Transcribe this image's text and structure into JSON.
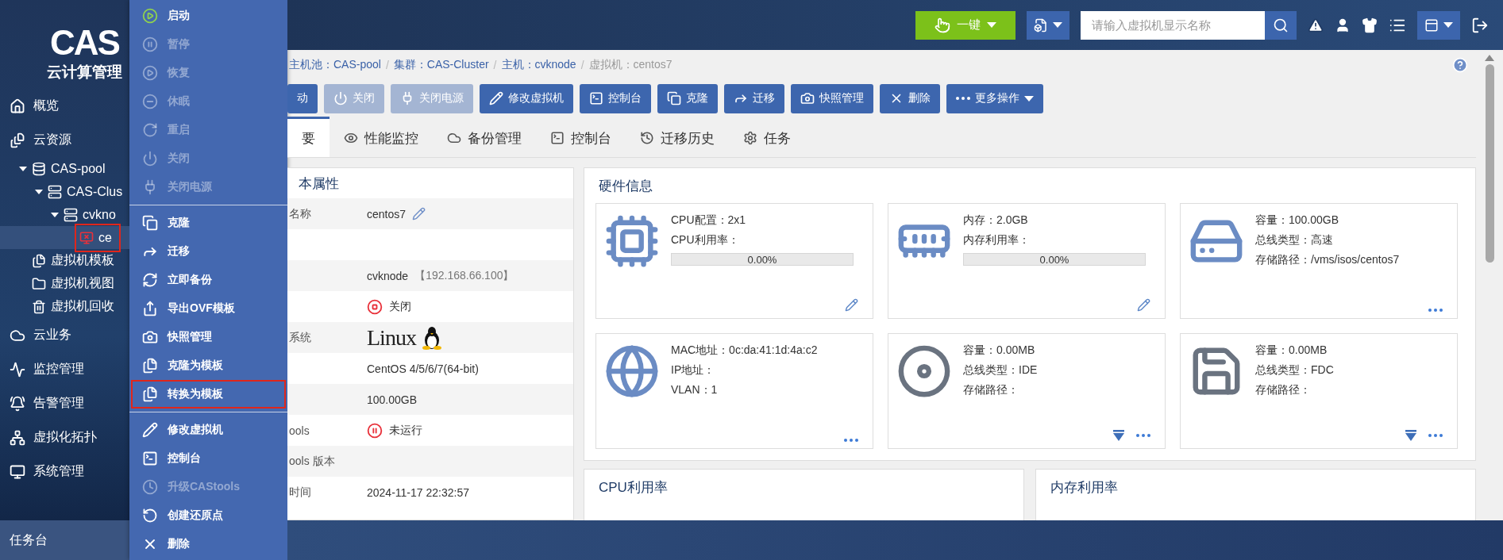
{
  "logo": {
    "mark": "CAS",
    "title": "云计算管理"
  },
  "sidebar": {
    "items": [
      {
        "label": "概览",
        "kind": "home",
        "selected": false
      },
      {
        "label": "云资源",
        "kind": "resources",
        "selected": false,
        "children": [
          {
            "label": "CAS-pool",
            "kind": "pool",
            "expanded": true,
            "selected": false,
            "highlighted": false,
            "children": [
              {
                "label": "CAS-Clus",
                "kind": "cluster",
                "expanded": true,
                "selected": false,
                "highlighted": false,
                "children": [
                  {
                    "label": "cvkno",
                    "kind": "host",
                    "expanded": true,
                    "selected": false,
                    "highlighted": false,
                    "children": [
                      {
                        "label": "ce",
                        "kind": "vm",
                        "selected": true,
                        "highlighted": true
                      }
                    ]
                  }
                ]
              }
            ]
          },
          {
            "label": "虚拟机模板",
            "kind": "template",
            "selected": false,
            "highlighted": false
          },
          {
            "label": "虚拟机视图",
            "kind": "folder",
            "selected": false,
            "highlighted": false
          },
          {
            "label": "虚拟机回收",
            "kind": "trash",
            "selected": false,
            "highlighted": false
          }
        ]
      },
      {
        "label": "云业务",
        "kind": "cloud",
        "selected": false
      },
      {
        "label": "监控管理",
        "kind": "monitor",
        "selected": false
      },
      {
        "label": "告警管理",
        "kind": "alarm",
        "selected": false
      },
      {
        "label": "虚拟化拓扑",
        "kind": "topology",
        "selected": false
      },
      {
        "label": "系统管理",
        "kind": "system",
        "selected": false
      }
    ]
  },
  "context_menu": {
    "groups": [
      {
        "items": [
          {
            "label": "启动",
            "kind": "start",
            "disabled": false,
            "highlighted": false
          },
          {
            "label": "暂停",
            "kind": "pause",
            "disabled": true,
            "highlighted": false
          },
          {
            "label": "恢复",
            "kind": "resume",
            "disabled": true,
            "highlighted": false
          },
          {
            "label": "休眠",
            "kind": "sleep",
            "disabled": true,
            "highlighted": false
          },
          {
            "label": "重启",
            "kind": "restart",
            "disabled": true,
            "highlighted": false
          },
          {
            "label": "关闭",
            "kind": "power",
            "disabled": true,
            "highlighted": false
          },
          {
            "label": "关闭电源",
            "kind": "plug",
            "disabled": true,
            "highlighted": false
          }
        ]
      },
      {
        "items": [
          {
            "label": "克隆",
            "kind": "clone",
            "disabled": false,
            "highlighted": false
          },
          {
            "label": "迁移",
            "kind": "migrate",
            "disabled": false,
            "highlighted": false
          },
          {
            "label": "立即备份",
            "kind": "backup",
            "disabled": false,
            "highlighted": false
          },
          {
            "label": "导出OVF模板",
            "kind": "export",
            "disabled": false,
            "highlighted": false
          },
          {
            "label": "快照管理",
            "kind": "snapshot",
            "disabled": false,
            "highlighted": false
          },
          {
            "label": "克隆为模板",
            "kind": "template",
            "disabled": false,
            "highlighted": false
          },
          {
            "label": "转换为模板",
            "kind": "template",
            "disabled": false,
            "highlighted": true
          }
        ]
      },
      {
        "items": [
          {
            "label": "修改虚拟机",
            "kind": "edit",
            "disabled": false,
            "highlighted": false
          },
          {
            "label": "控制台",
            "kind": "console",
            "disabled": false,
            "highlighted": false
          },
          {
            "label": "升级CAStools",
            "kind": "upgrade",
            "disabled": true,
            "highlighted": false
          },
          {
            "label": "创建还原点",
            "kind": "restore",
            "disabled": false,
            "highlighted": false
          },
          {
            "label": "删除",
            "kind": "delete",
            "disabled": false,
            "highlighted": false
          }
        ]
      }
    ]
  },
  "topbar": {
    "quick_button": "一键",
    "search": {
      "placeholder": "请输入虚拟机显示名称"
    }
  },
  "breadcrumb": [
    {
      "label": "主机池：CAS-pool",
      "current": false
    },
    {
      "separator": "/",
      "label": "集群：CAS-Cluster",
      "current": false
    },
    {
      "separator": "/",
      "label": "主机：cvknode",
      "current": false
    },
    {
      "separator": "/",
      "label": "虚拟机：centos7",
      "current": true
    }
  ],
  "toolbar": [
    {
      "label": "动",
      "kind": "plain",
      "disabled": false
    },
    {
      "label": "关闭",
      "kind": "power",
      "disabled": true
    },
    {
      "label": "关闭电源",
      "kind": "plug",
      "disabled": true
    },
    {
      "label": "修改虚拟机",
      "kind": "edit",
      "disabled": false
    },
    {
      "label": "控制台",
      "kind": "console",
      "disabled": false
    },
    {
      "label": "克隆",
      "kind": "clone",
      "disabled": false
    },
    {
      "label": "迁移",
      "kind": "migrate",
      "disabled": false
    },
    {
      "label": "快照管理",
      "kind": "snapshot",
      "disabled": false
    },
    {
      "label": "删除",
      "kind": "delete",
      "disabled": false
    },
    {
      "label": "更多操作",
      "kind": "more",
      "disabled": false
    }
  ],
  "tabs": [
    {
      "label": "要",
      "kind": "plain",
      "selected": true
    },
    {
      "label": "性能监控",
      "kind": "monitoring",
      "selected": false
    },
    {
      "label": "备份管理",
      "kind": "backup",
      "selected": false
    },
    {
      "label": "控制台",
      "kind": "console",
      "selected": false
    },
    {
      "label": "迁移历史",
      "kind": "history",
      "selected": false
    },
    {
      "label": "任务",
      "kind": "task",
      "selected": false
    }
  ],
  "properties": {
    "title": "本属性",
    "rows": [
      {
        "kind": "editable",
        "label": "名称",
        "value": "centos7"
      },
      {
        "kind": "blank"
      },
      {
        "kind": "text",
        "value": "cvknode",
        "note": "【192.168.66.100】"
      },
      {
        "kind": "power-state",
        "value": "关闭"
      },
      {
        "kind": "logo",
        "label": "系统",
        "value": "Linux"
      },
      {
        "kind": "text",
        "value": "CentOS 4/5/6/7(64-bit)"
      },
      {
        "kind": "text",
        "value": "100.00GB"
      },
      {
        "kind": "tools-state",
        "label": "ools",
        "value": "未运行"
      },
      {
        "kind": "text",
        "label": "ools 版本"
      },
      {
        "kind": "text",
        "label": "时间",
        "value": "2024-11-17 22:32:57"
      }
    ]
  },
  "hardware": {
    "title": "硬件信息",
    "cards": [
      {
        "kind": "cpu",
        "lines": [
          "CPU配置：2x1",
          "CPU利用率："
        ],
        "usage": {
          "level": 0,
          "reading": "0.00%"
        }
      },
      {
        "kind": "memory",
        "lines": [
          "内存：2.0GB",
          "内存利用率："
        ],
        "usage": {
          "level": 0,
          "reading": "0.00%"
        }
      },
      {
        "kind": "disk",
        "lines": [
          "容量：100.00GB",
          "总线类型：高速",
          "存储路径：/vms/isos/centos7"
        ]
      },
      {
        "kind": "network",
        "lines": [
          "MAC地址：0c:da:41:1d:4a:c2",
          "IP地址：",
          "VLAN：1"
        ]
      },
      {
        "kind": "cdrom",
        "lines": [
          "容量：0.00MB",
          "总线类型：IDE",
          "存储路径："
        ]
      },
      {
        "kind": "floppy",
        "lines": [
          "容量：0.00MB",
          "总线类型：FDC",
          "存储路径："
        ]
      }
    ]
  },
  "charts": [
    {
      "title": "CPU利用率"
    },
    {
      "title": "内存利用率"
    }
  ],
  "taskbar": {
    "label": "任务台"
  }
}
